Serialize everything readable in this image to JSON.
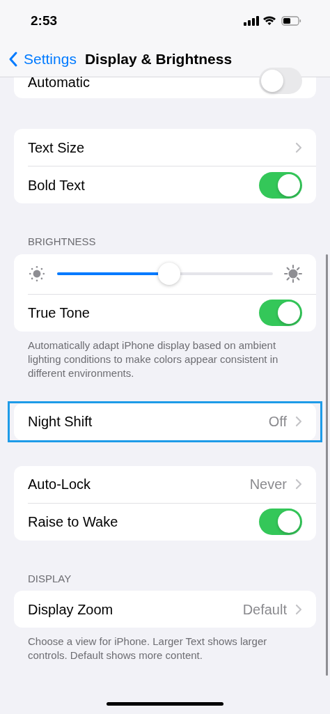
{
  "status_bar": {
    "time": "2:53"
  },
  "nav": {
    "back": "Settings",
    "title": "Display & Brightness"
  },
  "groups": [
    {
      "cut_top": true,
      "highlighted": false,
      "rows": [
        {
          "kind": "toggle",
          "label": "Automatic",
          "on": false
        }
      ]
    },
    {
      "highlighted": false,
      "rows": [
        {
          "kind": "link",
          "label": "Text Size"
        },
        {
          "kind": "toggle",
          "label": "Bold Text",
          "on": true
        }
      ]
    },
    {
      "header": "BRIGHTNESS",
      "highlighted": false,
      "rows": [
        {
          "kind": "slider",
          "level": 0.52
        },
        {
          "kind": "toggle",
          "label": "True Tone",
          "on": true
        }
      ],
      "footer": "Automatically adapt iPhone display based on ambient lighting conditions to make colors appear consistent in different environments."
    },
    {
      "highlighted": true,
      "rows": [
        {
          "kind": "link",
          "label": "Night Shift",
          "value": "Off"
        }
      ]
    },
    {
      "highlighted": false,
      "rows": [
        {
          "kind": "link",
          "label": "Auto-Lock",
          "value": "Never"
        },
        {
          "kind": "toggle",
          "label": "Raise to Wake",
          "on": true
        }
      ]
    },
    {
      "header": "DISPLAY",
      "highlighted": false,
      "rows": [
        {
          "kind": "link",
          "label": "Display Zoom",
          "value": "Default"
        }
      ],
      "footer": "Choose a view for iPhone. Larger Text shows larger controls. Default shows more content."
    }
  ]
}
